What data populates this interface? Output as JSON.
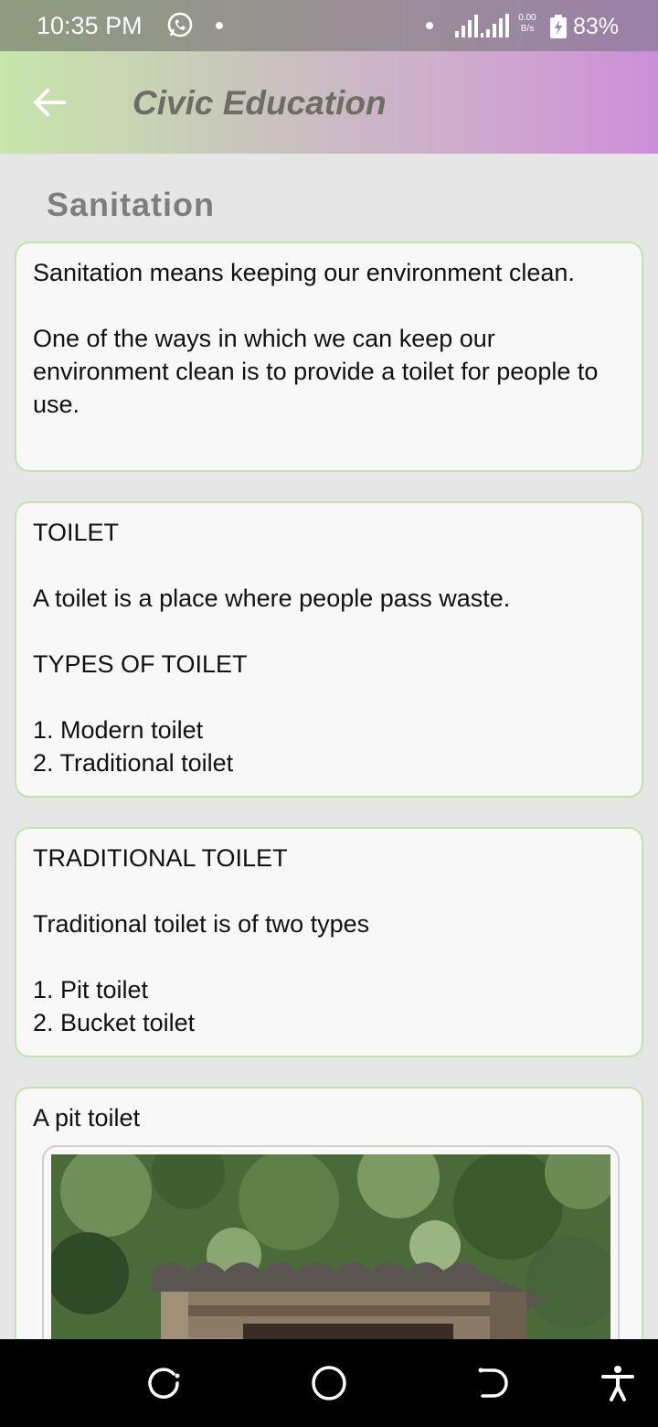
{
  "status_bar": {
    "time": "10:35 PM",
    "net_speed_value": "0.00",
    "net_speed_unit": "B/s",
    "battery": "83%"
  },
  "app_bar": {
    "title": "Civic Education",
    "back_icon": "arrow-left-icon"
  },
  "section": {
    "title": "Sanitation"
  },
  "cards": [
    {
      "lines": [
        "Sanitation means keeping our environment clean.",
        "One of the ways in which we can keep our environment clean is to provide a toilet for people to use."
      ]
    },
    {
      "heading": "TOILET",
      "definition": "A toilet is a place where people pass waste.",
      "subheading": "TYPES OF TOILET",
      "items": [
        "1. Modern toilet",
        "2. Traditional toilet"
      ]
    },
    {
      "heading": "TRADITIONAL TOILET",
      "definition": "Traditional toilet is of two types",
      "items": [
        "1. Pit toilet",
        "2. Bucket toilet"
      ]
    },
    {
      "caption": "A pit toilet",
      "image": "pit-toilet-photo"
    }
  ],
  "nav_bar": {
    "recents": "recents-icon",
    "home": "home-icon",
    "back": "back-icon",
    "accessibility": "accessibility-icon"
  },
  "colors": {
    "card_border": "#c7e1ad",
    "background": "#e6e6e6"
  }
}
